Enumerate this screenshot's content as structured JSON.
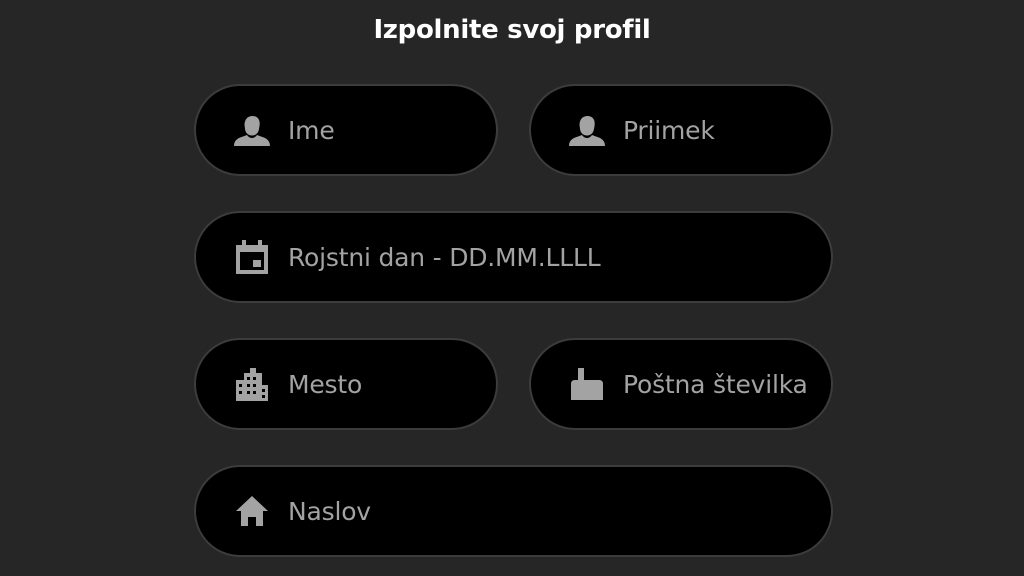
{
  "title": "Izpolnite svoj profil",
  "colors": {
    "background": "#262626",
    "field_background": "#000000",
    "field_border": "#3c3c3c",
    "placeholder_text": "#a3a3a3",
    "icon": "#a3a3a3",
    "title_text": "#ffffff"
  },
  "fields": {
    "first_name": {
      "placeholder": "Ime",
      "value": "",
      "icon": "person-icon"
    },
    "last_name": {
      "placeholder": "Priimek",
      "value": "",
      "icon": "person-icon"
    },
    "birthday": {
      "placeholder": "Rojstni dan - DD.MM.LLLL",
      "value": "",
      "icon": "calendar-icon"
    },
    "city": {
      "placeholder": "Mesto",
      "value": "",
      "icon": "city-icon"
    },
    "postal_code": {
      "placeholder": "Poštna številka",
      "value": "",
      "icon": "mailbox-icon"
    },
    "address": {
      "placeholder": "Naslov",
      "value": "",
      "icon": "home-icon"
    }
  }
}
